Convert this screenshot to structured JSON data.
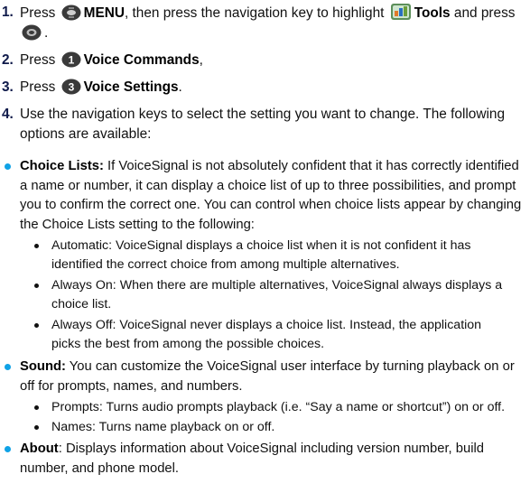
{
  "steps": [
    {
      "number": "1.",
      "parts": {
        "p1": "Press ",
        "menu": "MENU",
        "p2": ", then press the navigation key to highlight ",
        "tools": "Tools",
        "p3": " and press ",
        "p4": "."
      },
      "icons": [
        "menu-key-icon",
        "tools-app-icon",
        "ok-key-icon"
      ]
    },
    {
      "number": "2.",
      "pre": "Press ",
      "label": "Voice Commands",
      "post": ",",
      "key": "1"
    },
    {
      "number": "3.",
      "pre": "Press ",
      "label": "Voice Settings",
      "post": ".",
      "key": "3"
    },
    {
      "number": "4.",
      "text": "Use the navigation keys to select the setting you want to change. The following options are available:"
    }
  ],
  "options": [
    {
      "title": "Choice Lists:",
      "text": " If VoiceSignal is not absolutely confident that it has correctly identified a name or number, it can display a choice list of up to three possibilities, and prompt you to confirm the correct one. You can control when choice lists appear by changing the Choice Lists setting to the following:",
      "items": [
        "Automatic: VoiceSignal displays a choice list when it is not confident it has identified the correct choice from among multiple alternatives.",
        "Always On: When there are multiple alternatives, VoiceSignal always displays a choice list.",
        "Always Off: VoiceSignal never displays a choice list. Instead, the application picks the best from among the possible choices."
      ]
    },
    {
      "title": "Sound:",
      "text": " You can customize the VoiceSignal user interface by turning playback on or off for prompts, names, and numbers.",
      "items": [
        "Prompts: Turns audio prompts playback (i.e. “Say a name or shortcut”) on or off.",
        "Names: Turns name playback on or off."
      ]
    },
    {
      "title": "About",
      "text": ": Displays information about VoiceSignal including version number, build number, and phone model.",
      "items": []
    }
  ],
  "colors": {
    "bullet": "#0fa2e6",
    "text": "#111111",
    "key_icon": "#3a3a3a"
  }
}
